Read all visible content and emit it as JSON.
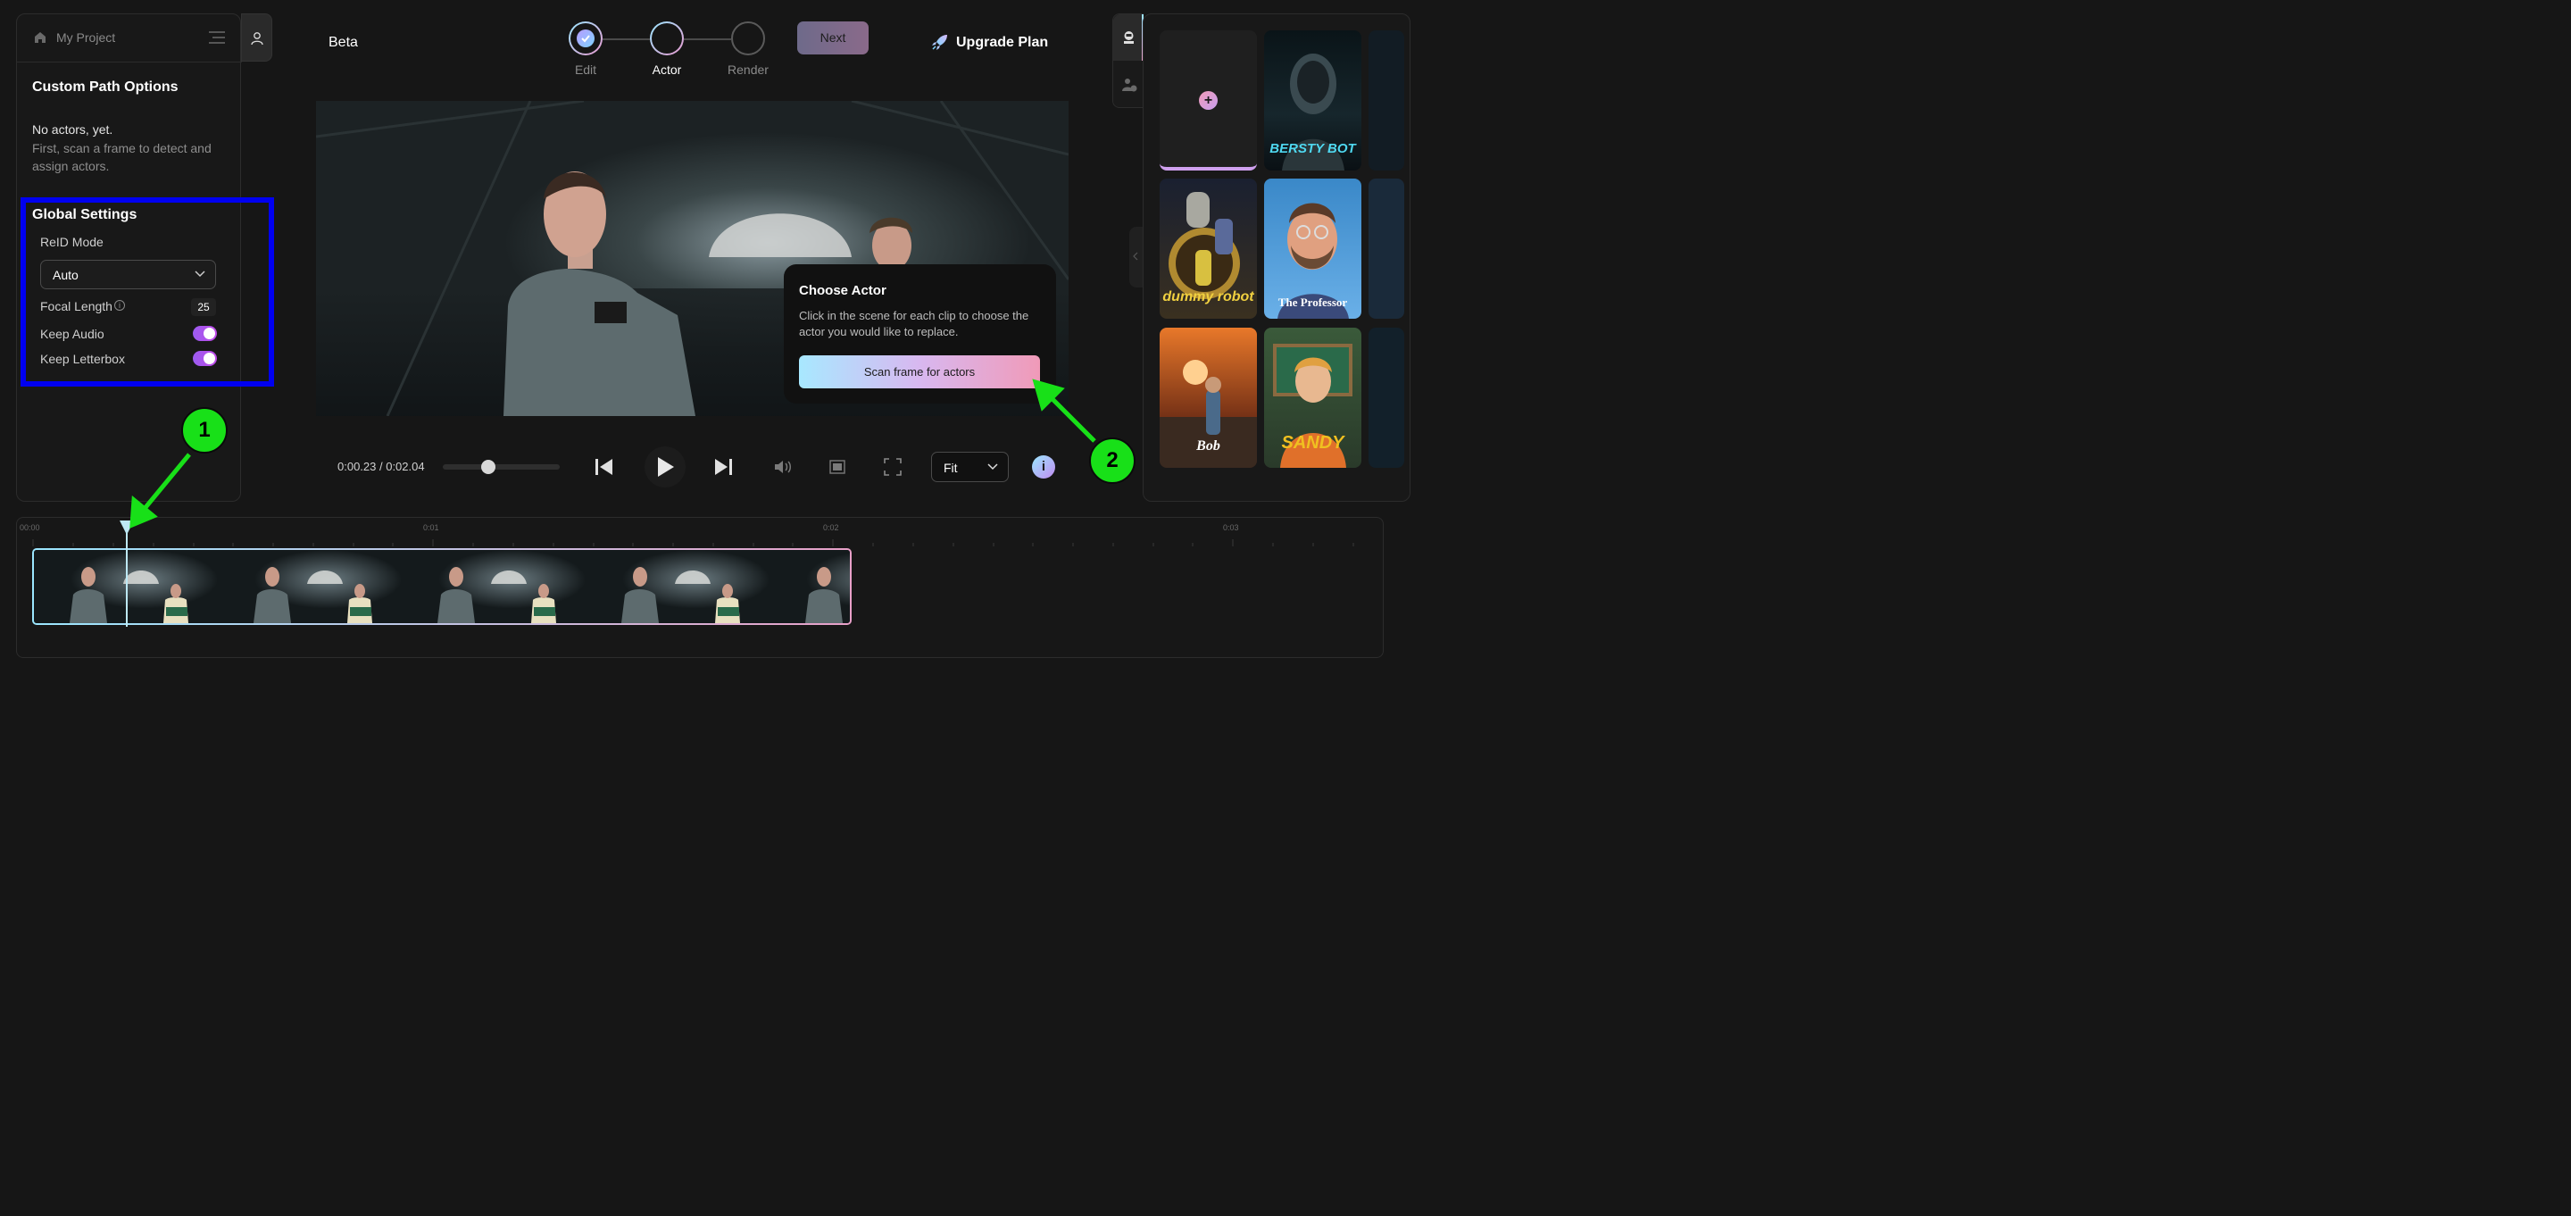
{
  "project": {
    "name": "My Project"
  },
  "left_panel": {
    "title": "Custom Path Options",
    "no_actors": "No actors, yet.",
    "hint": "First, scan a frame to detect and assign actors."
  },
  "global_settings": {
    "title": "Global Settings",
    "reid_label": "ReID Mode",
    "reid_value": "Auto",
    "focal_label": "Focal Length",
    "focal_value": "25",
    "keep_audio_label": "Keep Audio",
    "keep_audio_on": true,
    "keep_letterbox_label": "Keep Letterbox",
    "keep_letterbox_on": true
  },
  "header": {
    "beta": "Beta",
    "steps": [
      {
        "label": "Edit",
        "state": "done"
      },
      {
        "label": "Actor",
        "state": "active"
      },
      {
        "label": "Render",
        "state": "pending"
      }
    ],
    "next_label": "Next",
    "upgrade_label": "Upgrade Plan"
  },
  "popup": {
    "title": "Choose Actor",
    "text": "Click in the scene for each clip to choose the actor you would like to replace.",
    "button": "Scan frame for actors"
  },
  "player": {
    "timecode": "0:00.23 / 0:02.04",
    "progress": 0.39,
    "fit_value": "Fit",
    "info": "i"
  },
  "actors": [
    {
      "name": "BERSTY BOT",
      "color": "#4fd8f0"
    },
    {
      "name": "dummy robot",
      "color": "#f0d040"
    },
    {
      "name": "The Professor",
      "color": "#ffffff"
    },
    {
      "name": "Bob",
      "color": "#ffffff"
    },
    {
      "name": "SANDY",
      "color": "#f0c020"
    }
  ],
  "timeline": {
    "ticks": [
      "00:00",
      "0:01",
      "0:02",
      "0:03"
    ]
  },
  "annotations": {
    "callout_1": "1",
    "callout_2": "2"
  },
  "colors": {
    "accent_purple": "#b062f0",
    "highlight_box": "#0000f0",
    "callout_green": "#18e018"
  }
}
